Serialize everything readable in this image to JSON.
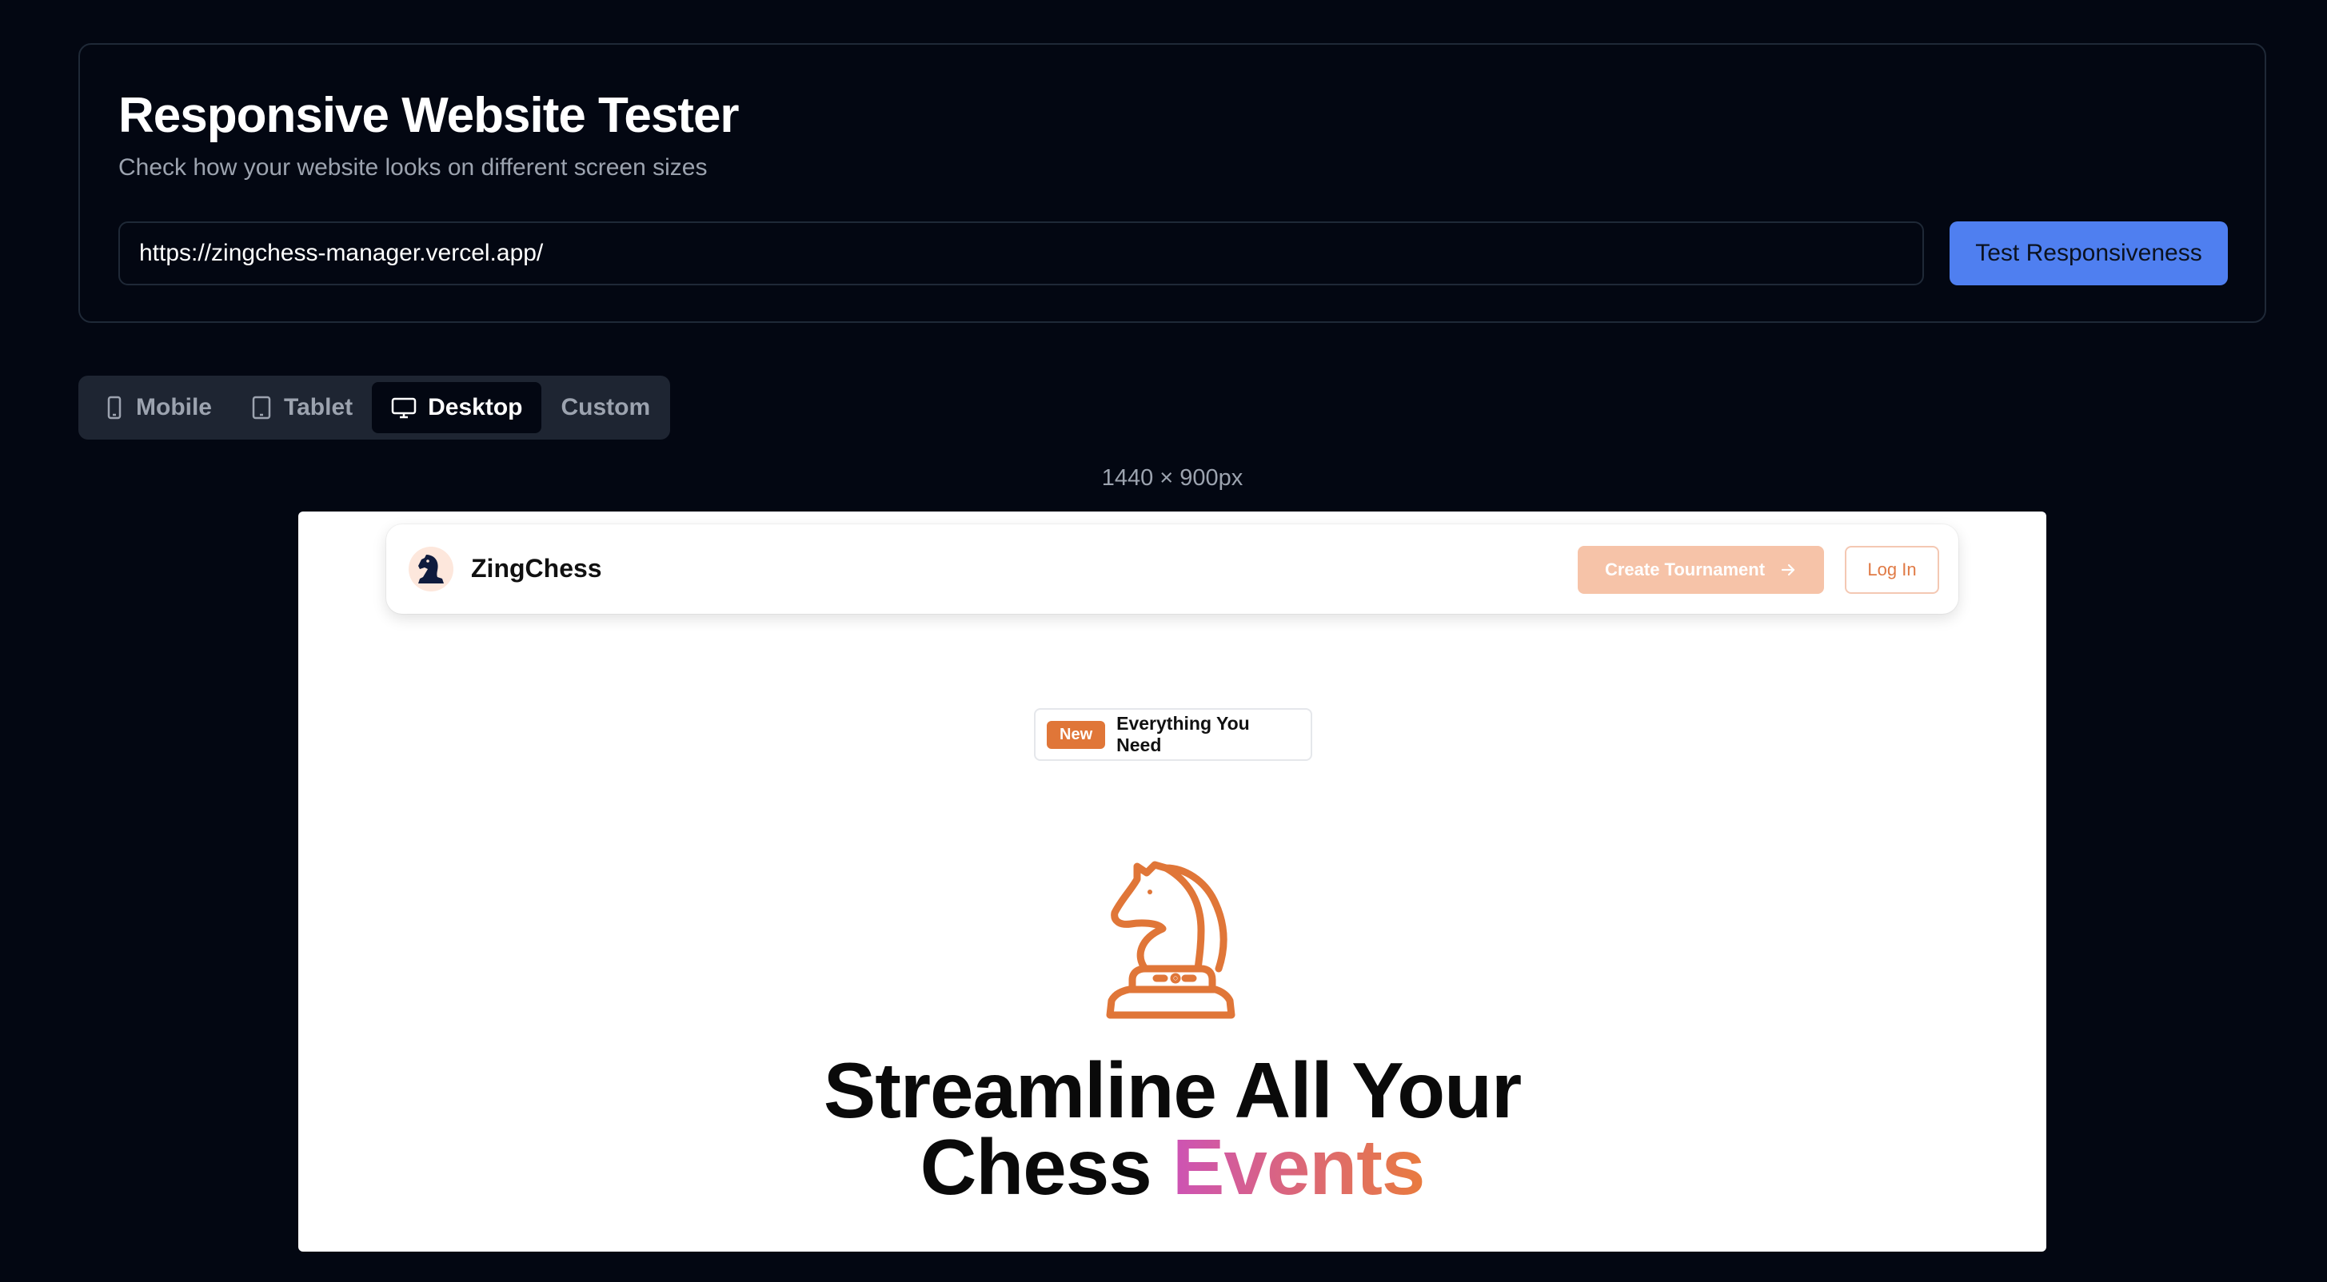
{
  "header": {
    "title": "Responsive Website Tester",
    "subtitle": "Check how your website looks on different screen sizes"
  },
  "url_input": {
    "value": "https://zingchess-manager.vercel.app/"
  },
  "test_button": {
    "label": "Test Responsiveness"
  },
  "device_tabs": [
    {
      "label": "Mobile",
      "icon": "smartphone-icon",
      "active": false
    },
    {
      "label": "Tablet",
      "icon": "tablet-icon",
      "active": false
    },
    {
      "label": "Desktop",
      "icon": "monitor-icon",
      "active": true
    },
    {
      "label": "Custom",
      "icon": "",
      "active": false
    }
  ],
  "viewport_label": "1440 × 900px",
  "preview": {
    "brand": "ZingChess",
    "create_button": "Create Tournament",
    "login_button": "Log In",
    "badge_new": "New",
    "badge_text": "Everything You Need",
    "headline_line1": "Streamline All Your",
    "headline_word": "Chess",
    "headline_highlight": "Events",
    "accent_color": "#e07638",
    "gradient": [
      "#cd53b5",
      "#e97b3e"
    ]
  },
  "colors": {
    "background": "#030712",
    "primary_button": "#4f7ff0"
  }
}
